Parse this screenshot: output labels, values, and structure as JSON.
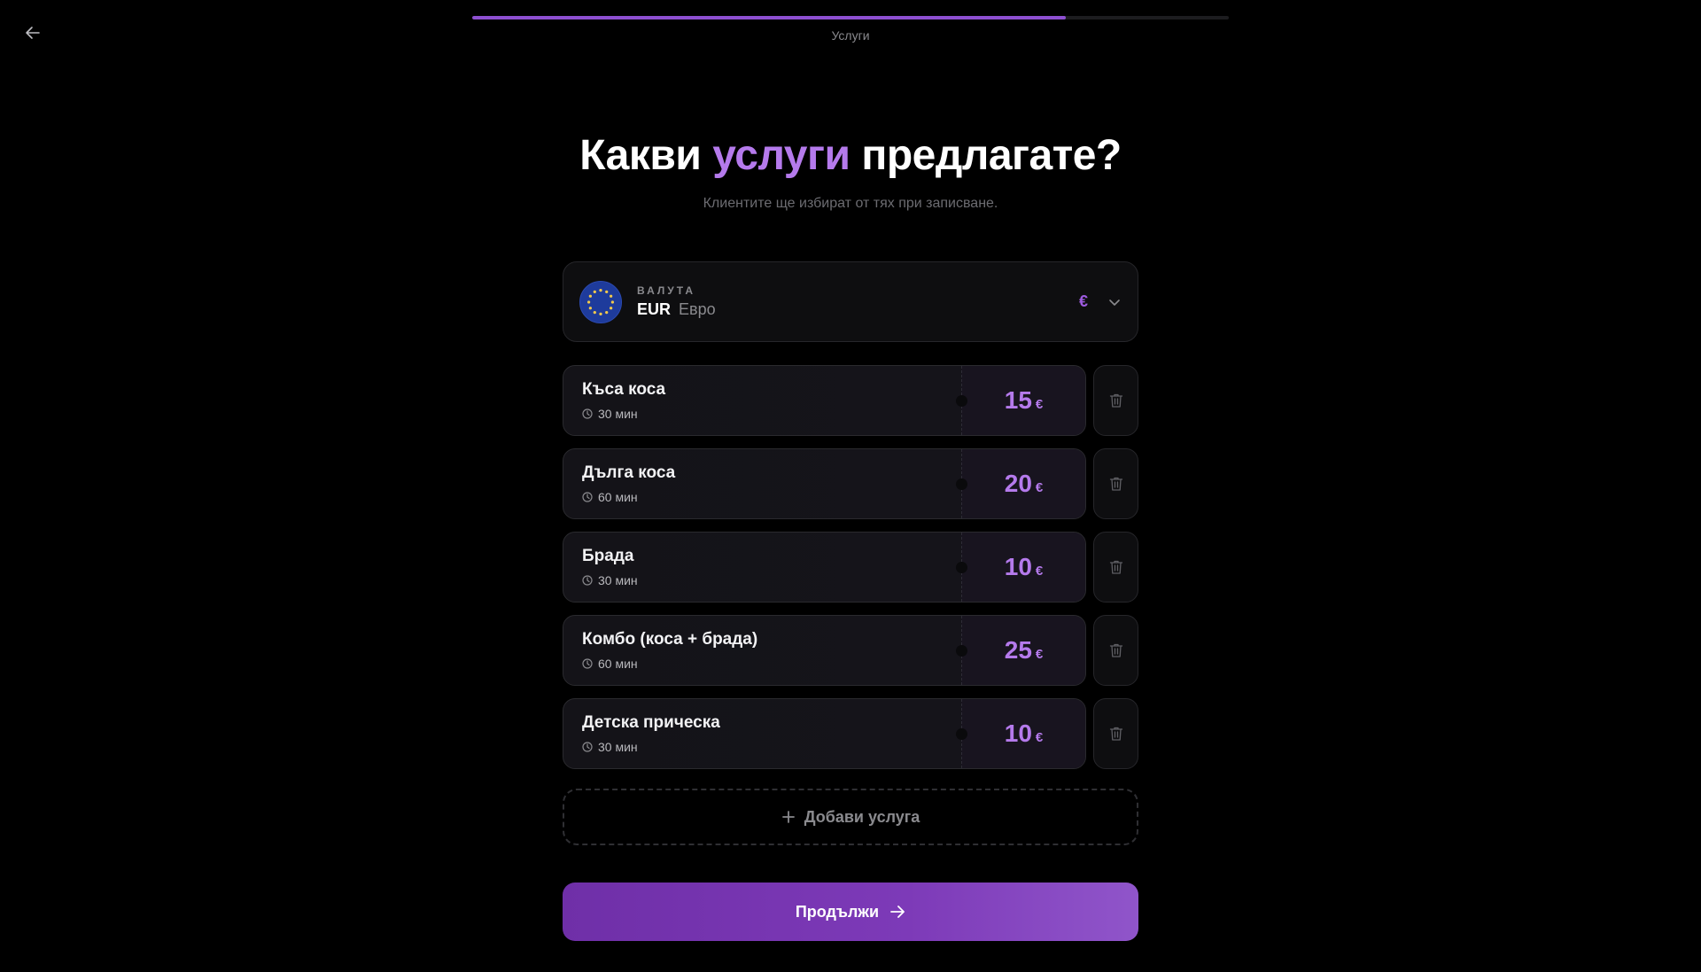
{
  "header": {
    "step_label": "Услуги",
    "progress_fraction": 0.785
  },
  "heading": {
    "before": "Какви",
    "accent": "услуги",
    "after": "предлагате?"
  },
  "subtitle": "Клиентите ще избират от тях при записване.",
  "currency": {
    "caption": "ВАЛУТА",
    "code": "EUR",
    "name": "Евро",
    "symbol": "€"
  },
  "services": [
    {
      "name": "Къса коса",
      "duration": "30 мин",
      "price": "15",
      "currency": "€"
    },
    {
      "name": "Дълга коса",
      "duration": "60 мин",
      "price": "20",
      "currency": "€"
    },
    {
      "name": "Брада",
      "duration": "30 мин",
      "price": "10",
      "currency": "€"
    },
    {
      "name": "Комбо (коса + брада)",
      "duration": "60 мин",
      "price": "25",
      "currency": "€"
    },
    {
      "name": "Детска прическа",
      "duration": "30 мин",
      "price": "10",
      "currency": "€"
    }
  ],
  "actions": {
    "add_service": "Добави услуга",
    "continue": "Продължи"
  },
  "icons": {
    "back": "arrow-left-icon",
    "flag": "eu-flag-icon",
    "chevron": "chevron-down-icon",
    "clock": "clock-icon",
    "delete": "trash-icon",
    "add": "plus-icon",
    "next": "arrow-right-icon"
  },
  "colors": {
    "accent": "#b57aec",
    "progress": "#8d4fd0",
    "button_start": "#6f2fa8",
    "button_end": "#9055ca"
  }
}
